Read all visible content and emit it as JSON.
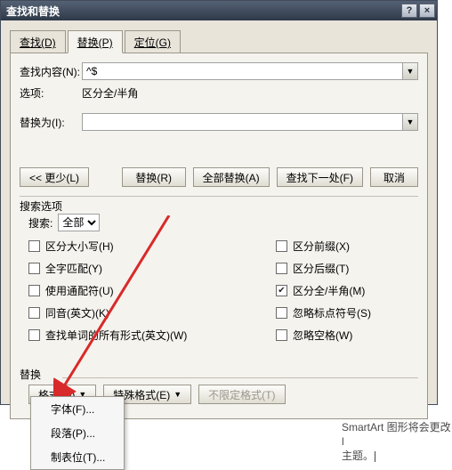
{
  "titlebar": {
    "title": "查找和替换",
    "help_glyph": "?",
    "close_glyph": "×"
  },
  "tabs": {
    "find": "查找(D)",
    "replace": "替换(P)",
    "goto": "定位(G)"
  },
  "fields": {
    "find_label": "查找内容(N):",
    "find_value": "^$",
    "options_label": "选项:",
    "options_value": "区分全/半角",
    "replace_label": "替换为(I):",
    "replace_value": ""
  },
  "buttons": {
    "less": "<< 更少(L)",
    "replace_one": "替换(R)",
    "replace_all": "全部替换(A)",
    "find_next": "查找下一处(F)",
    "cancel": "取消"
  },
  "search": {
    "section": "搜索选项",
    "search_label": "搜索:",
    "scope": "全部"
  },
  "checks": {
    "case": "区分大小写(H)",
    "whole": "全字匹配(Y)",
    "wildcard": "使用通配符(U)",
    "homophone": "同音(英文)(K)",
    "allforms": "查找单词的所有形式(英文)(W)",
    "prefix": "区分前缀(X)",
    "suffix": "区分后缀(T)",
    "fullhalf": "区分全/半角(M)",
    "punct": "忽略标点符号(S)",
    "space": "忽略空格(W)"
  },
  "replace_section": {
    "label": "替换",
    "format": "格式(O)",
    "special": "特殊格式(E)",
    "noformat": "不限定格式(T)"
  },
  "menu": {
    "font": "字体(F)...",
    "paragraph": "段落(P)...",
    "tabs": "制表位(T)..."
  },
  "residual": {
    "line1": "SmartArt 图形将会更改l",
    "line2": "主题。"
  }
}
